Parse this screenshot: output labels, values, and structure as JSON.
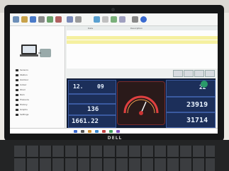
{
  "device": {
    "brand_logo": "DELL"
  },
  "toolbar": {
    "icons": [
      "home-icon",
      "folder-icon",
      "save-icon",
      "print-icon",
      "settings-icon",
      "refresh-icon",
      "chart-icon",
      "tools-icon",
      "help-icon",
      "globe-icon"
    ]
  },
  "tree": {
    "items": [
      "Sensors",
      "Station",
      "Outdoor",
      "Indoor",
      "Wind",
      "Rain",
      "Pressure",
      "History",
      "Graphs",
      "Settings"
    ]
  },
  "table": {
    "headers": [
      "",
      "Date",
      "Description"
    ],
    "rows": [
      {
        "cells": [
          "",
          "",
          ""
        ],
        "selected": false
      },
      {
        "cells": [
          "",
          "",
          ""
        ],
        "selected": true
      },
      {
        "cells": [
          "",
          "",
          ""
        ],
        "selected": true
      }
    ]
  },
  "dashboard": {
    "top_left_value": "12.",
    "top_mid_value": "09",
    "mid_left_value": "136",
    "bottom_left_value": "1661.22",
    "right_top_value": "22",
    "right_mid_value": "23919",
    "right_bottom_value": "31714"
  },
  "colors": {
    "accent_yellow": "#f5f0a0",
    "dash_bg": "#0f1a33",
    "lcd_text": "#e9f3ff"
  }
}
